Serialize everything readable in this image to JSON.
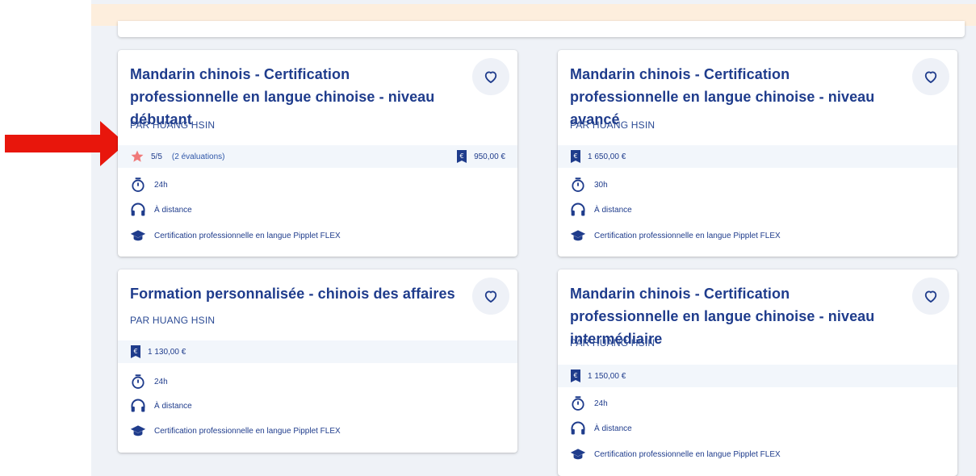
{
  "colors": {
    "accent": "#1f3c8c",
    "star": "#f07a7a",
    "arrow": "#e8160c",
    "banner": "#fdeedd",
    "background": "#eff2f7"
  },
  "cards": [
    {
      "title": "Mandarin chinois - Certification professionnelle en langue chinoise - niveau débutant",
      "author": "PAR HUANG HSIN",
      "rating": "5/5",
      "rating_count": "(2 évaluations)",
      "price": "950,00 €",
      "duration": "24h",
      "mode": "À distance",
      "certification": "Certification professionnelle en langue Pipplet FLEX"
    },
    {
      "title": "Mandarin chinois - Certification professionnelle en langue chinoise - niveau avancé",
      "author": "PAR HUANG HSIN",
      "price": "1 650,00 €",
      "duration": "30h",
      "mode": "À distance",
      "certification": "Certification professionnelle en langue Pipplet FLEX"
    },
    {
      "title": "Formation personnalisée - chinois des affaires",
      "author": "PAR HUANG HSIN",
      "price": "1 130,00 €",
      "duration": "24h",
      "mode": "À distance",
      "certification": "Certification professionnelle en langue Pipplet FLEX"
    },
    {
      "title": "Mandarin chinois - Certification professionnelle en langue chinoise - niveau intermédiaire",
      "author": "PAR HUANG HSIN",
      "price": "1 150,00 €",
      "duration": "24h",
      "mode": "À distance",
      "certification": "Certification professionnelle en langue Pipplet FLEX"
    }
  ]
}
